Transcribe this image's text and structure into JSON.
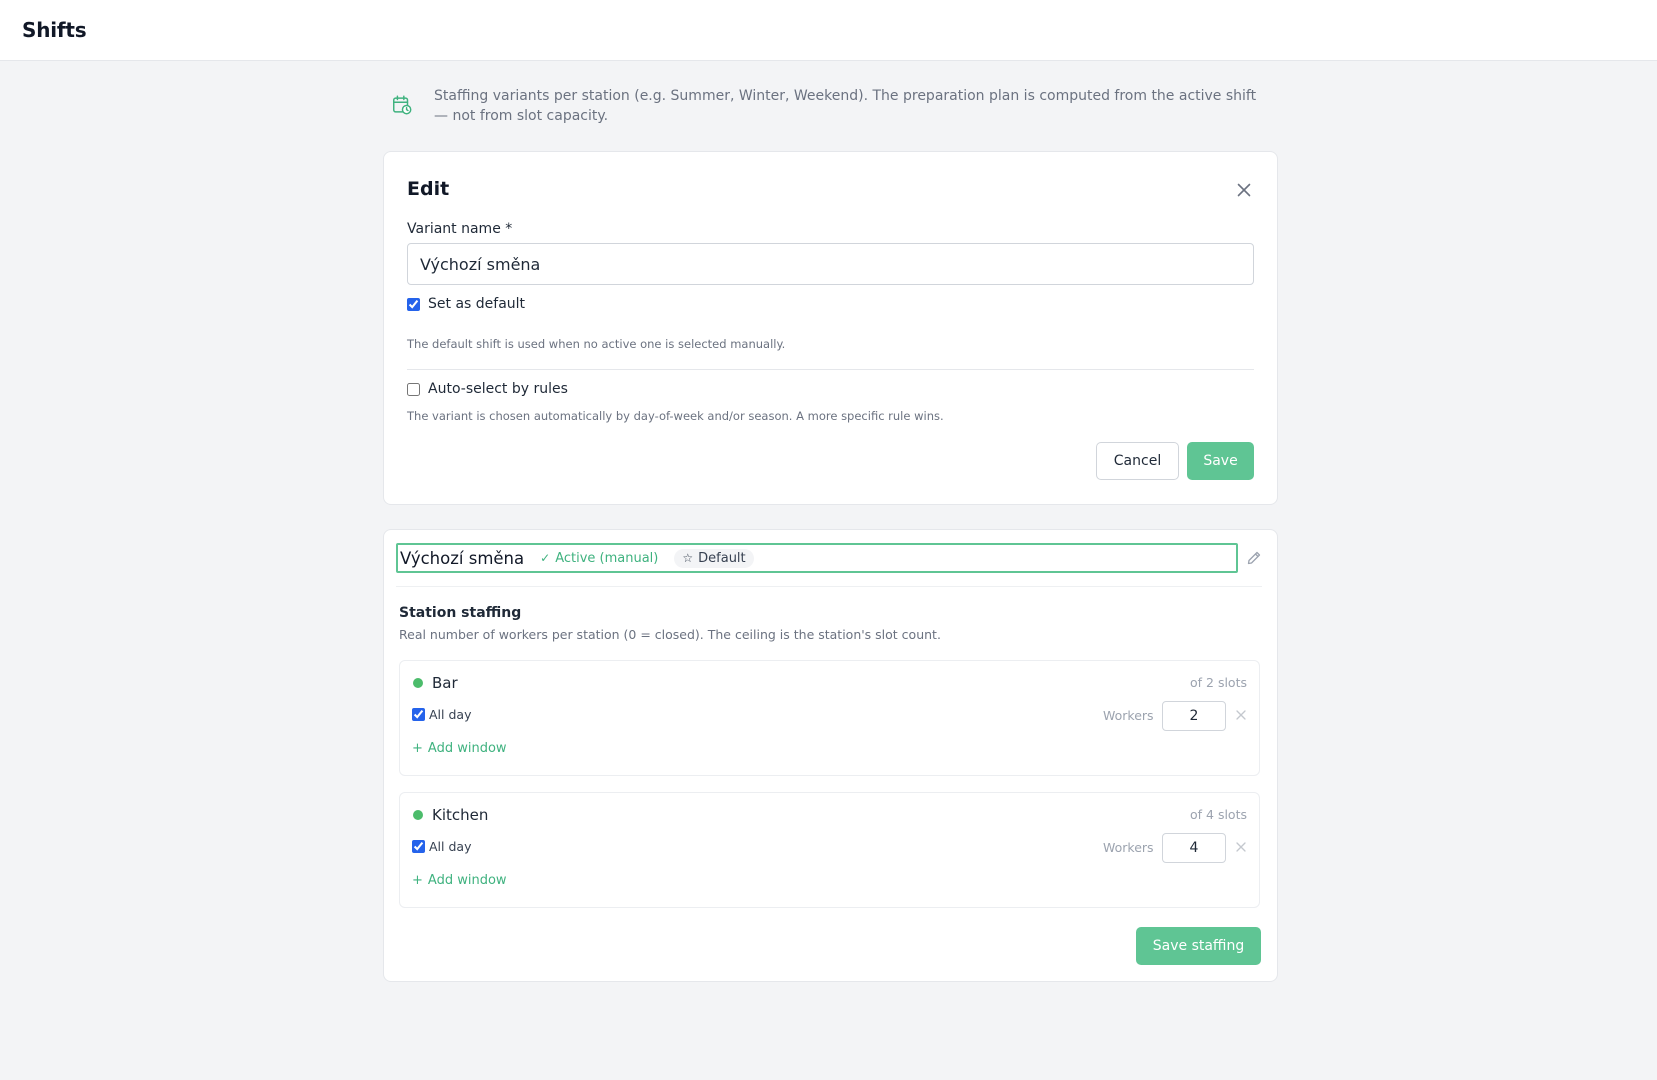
{
  "page": {
    "title": "Shifts"
  },
  "info": {
    "icon": "calendar-clock-icon",
    "text": "Staffing variants per station (e.g. Summer, Winter, Weekend). The preparation plan is computed from the active shift — not from slot capacity."
  },
  "edit_form": {
    "title": "Edit",
    "variant_name_label": "Variant name *",
    "variant_name_value": "Výchozí směna",
    "set_default_label": "Set as default",
    "set_default_checked": true,
    "default_help": "The default shift is used when no active one is selected manually.",
    "auto_select_label": "Auto-select by rules",
    "auto_select_checked": false,
    "auto_select_help": "The variant is chosen automatically by day-of-week and/or season. A more specific rule wins.",
    "cancel_label": "Cancel",
    "save_label": "Save"
  },
  "shift": {
    "name": "Výchozí směna",
    "active_badge": "Active (manual)",
    "default_badge": "Default",
    "section_title": "Station staffing",
    "section_desc": "Real number of workers per station (0 = closed). The ceiling is the station's slot count.",
    "stations": [
      {
        "name": "Bar",
        "slots_text": "of 2 slots",
        "all_day_label": "All day",
        "workers_label": "Workers",
        "workers": "2",
        "add_window_label": "Add window"
      },
      {
        "name": "Kitchen",
        "slots_text": "of 4 slots",
        "all_day_label": "All day",
        "workers_label": "Workers",
        "workers": "4",
        "add_window_label": "Add window"
      }
    ],
    "save_staffing_label": "Save staffing"
  },
  "colors": {
    "accent": "#5fc594",
    "accent_text": "#3fb27f",
    "station_dot": "#4cbc6b",
    "checkbox": "#2563eb"
  }
}
